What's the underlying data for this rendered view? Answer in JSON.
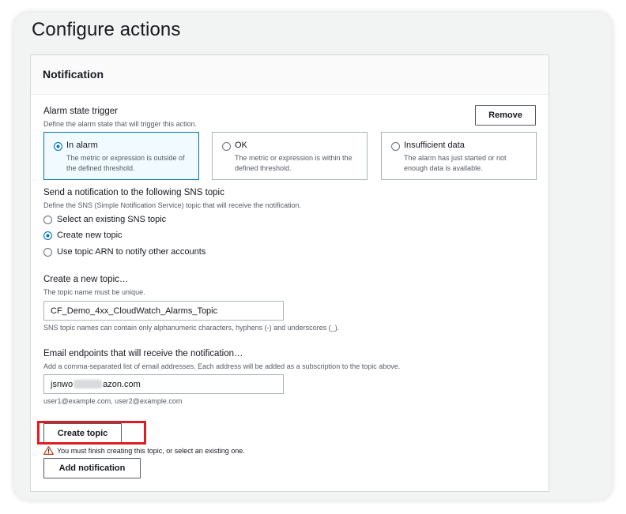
{
  "page": {
    "title": "Configure actions"
  },
  "panel": {
    "header": "Notification",
    "remove_label": "Remove",
    "alarm_state": {
      "label": "Alarm state trigger",
      "description": "Define the alarm state that will trigger this action.",
      "options": [
        {
          "title": "In alarm",
          "description": "The metric or expression is outside of the defined threshold.",
          "selected": true
        },
        {
          "title": "OK",
          "description": "The metric or expression is within the defined threshold.",
          "selected": false
        },
        {
          "title": "Insufficient data",
          "description": "The alarm has just started or not enough data is available.",
          "selected": false
        }
      ]
    },
    "sns": {
      "label": "Send a notification to the following SNS topic",
      "description": "Define the SNS (Simple Notification Service) topic that will receive the notification.",
      "options": [
        {
          "label": "Select an existing SNS topic",
          "selected": false
        },
        {
          "label": "Create new topic",
          "selected": true
        },
        {
          "label": "Use topic ARN to notify other accounts",
          "selected": false
        }
      ]
    },
    "new_topic": {
      "label": "Create a new topic…",
      "description": "The topic name must be unique.",
      "value": "CF_Demo_4xx_CloudWatch_Alarms_Topic",
      "constraint": "SNS topic names can contain only alphanumeric characters, hyphens (-) and underscores (_)."
    },
    "email": {
      "label": "Email endpoints that will receive the notification…",
      "description": "Add a comma-separated list of email addresses. Each address will be added as a subscription to the topic above.",
      "value_prefix": "jsnwo",
      "value_suffix": "azon.com",
      "hint": "user1@example.com, user2@example.com"
    },
    "create_topic_label": "Create topic",
    "warning": "You must finish creating this topic, or select an existing one.",
    "add_notification_label": "Add notification"
  },
  "colors": {
    "accent": "#0073bb",
    "highlight": "#e01b24",
    "selected_tile_bg": "#f1faff"
  }
}
